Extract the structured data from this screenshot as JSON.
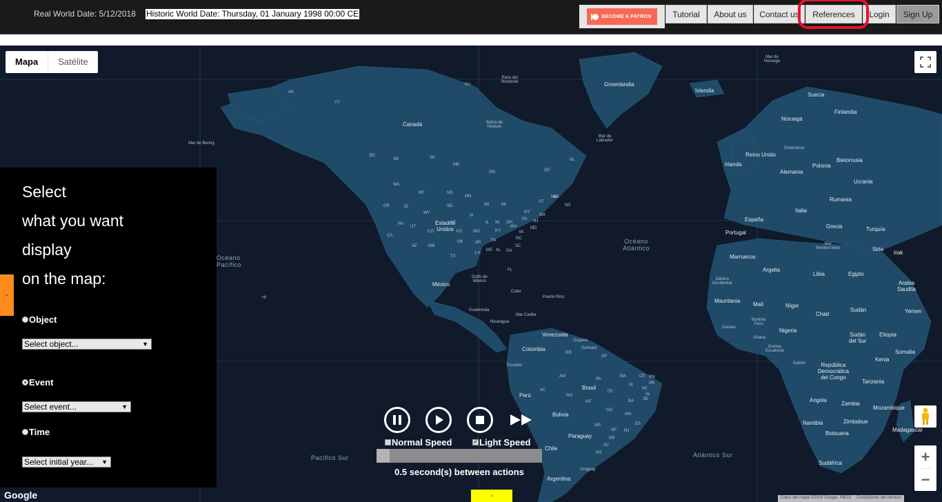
{
  "header": {
    "real_date": "Real World Date: 5/12/2018",
    "historic_date": "Historic World Date: Thursday, 01 January 1998 00:00 CE",
    "patron_label": "BECOME A PATRON",
    "nav": {
      "tutorial": "Tutorial",
      "about": "About us",
      "contact": "Contact us",
      "references": "References",
      "login": "Login",
      "signup": "Sign Up"
    }
  },
  "map": {
    "type_map": "Mapa",
    "type_satellite": "Satélite",
    "google_logo": "Google",
    "attribution_data": "Datos del mapa ©2018 Google, INEGI",
    "attribution_terms": "Condiciones del servicio",
    "zoom_in": "+",
    "zoom_out": "−",
    "oceans": {
      "atlantic": [
        "Océano",
        "Atlántico"
      ],
      "pacific": [
        "Océano",
        "Pacífico"
      ],
      "pacifico_sur": "Pacífico Sur",
      "atlantico_sur": "Atlántico Sur"
    },
    "seas": {
      "bering": "Mar de Bering",
      "bahia_hudson": [
        "Bahía de",
        "Hudson"
      ],
      "labrador": [
        "Mar de",
        "Labrador"
      ],
      "noruega": [
        "Mar de",
        "Noruega"
      ],
      "mar_noroeste": [
        "Paso del",
        "Noroeste"
      ],
      "golfo_mexico": [
        "Golfo de",
        "México"
      ],
      "caribe": "Mar Caribe",
      "mediterraneo": [
        "Mar",
        "Mediterráneo"
      ]
    },
    "countries": {
      "groenlandia": "Groenlandia",
      "islandia": "Islandia",
      "canada": "Canadá",
      "suecia": "Suecia",
      "finlandia": "Finlandia",
      "noruega": "Noruega",
      "irlanda": "Irlanda",
      "reino_unido": "Reino Unido",
      "dinamarca": "Dinamarca",
      "alemania": "Alemania",
      "polonia": "Polonia",
      "bielorrusia": "Bielorrusia",
      "ucrania": "Ucrania",
      "rumania": "Rumania",
      "italia": "Italia",
      "grecia": "Grecia",
      "turquia": "Turquía",
      "espana": "España",
      "portugal": "Portugal",
      "marruecos": "Marruecos",
      "argelia": "Argelia",
      "libia": "Libia",
      "egipto": "Egipto",
      "irak": "Irak",
      "siria": "Siria",
      "arabia": [
        "Arabia",
        "Saudita"
      ],
      "yemen": "Yemen",
      "sahara": [
        "Sáhara",
        "Occidental"
      ],
      "mauritania": "Mauritania",
      "mali": "Malí",
      "niger": "Níger",
      "chad": "Chad",
      "sudan": "Sudán",
      "burkina": [
        "Burkina",
        "Faso"
      ],
      "guinea": "Guinea",
      "nigeria": "Nigeria",
      "etiopia": "Etiopía",
      "sudan_sur": [
        "Sudán",
        "del Sur"
      ],
      "ghana": "Ghana",
      "somalia": "Somalia",
      "kenia": "Kenia",
      "guinea_ec": [
        "Guinea",
        "Ecuatorial"
      ],
      "gabon": "Gabón",
      "rdc": [
        "República",
        "Democrática",
        "del Congo"
      ],
      "tanzania": "Tanzania",
      "angola": "Angola",
      "zambia": "Zambia",
      "mozambique": "Mozambique",
      "namibia": "Namibia",
      "zimbabue": "Zimbabue",
      "botsuana": "Botsuana",
      "madagascar": "Madagascar",
      "sudafrica": "Sudáfrica",
      "eeuu": [
        "Estados",
        "Unidos"
      ],
      "mexico": "México",
      "cuba": "Cuba",
      "puerto_rico": "Puerto Rico",
      "guatemala": "Guatemala",
      "nicaragua": "Nicaragua",
      "venezuela": "Venezuela",
      "guyana": "Guyana",
      "surinam": "Surinam",
      "colombia": "Colombia",
      "ecuador": "Ecuador",
      "peru": "Perú",
      "brasil": "Brasil",
      "bolivia": "Bolivia",
      "paraguay": "Paraguay",
      "chile": "Chile",
      "uruguay": "Uruguay",
      "argentina": "Argentina"
    },
    "states": [
      "AK",
      "YT",
      "NU",
      "BC",
      "AB",
      "SK",
      "MB",
      "ON",
      "QC",
      "NL",
      "NB",
      "NS",
      "WA",
      "MT",
      "ND",
      "MN",
      "WI",
      "MI",
      "NY",
      "VT",
      "ME",
      "OR",
      "ID",
      "WY",
      "SD",
      "IA",
      "IL",
      "IN",
      "OH",
      "PA",
      "NJ",
      "MA",
      "NV",
      "UT",
      "CO",
      "NE",
      "KS",
      "MO",
      "KY",
      "WV",
      "VA",
      "MD",
      "CA",
      "AZ",
      "NM",
      "OK",
      "AR",
      "TN",
      "NC",
      "SC",
      "TX",
      "LA",
      "MS",
      "AL",
      "GA",
      "FL",
      "HI",
      "AM",
      "PA",
      "MA",
      "CE",
      "RN",
      "PB",
      "PE",
      "AL",
      "SE",
      "TO",
      "BA",
      "PI",
      "AC",
      "RO",
      "MT",
      "GO",
      "MG",
      "ES",
      "MS",
      "SP",
      "RJ",
      "PR",
      "SC",
      "RS",
      "AP",
      "RR",
      "MO"
    ]
  },
  "panel": {
    "title_lines": [
      "Select",
      "what you want",
      "display",
      "on the map:"
    ],
    "object_label": "Object",
    "object_select": "Select object...",
    "event_label": "Event",
    "event_select": "Select event...",
    "time_label": "Time",
    "time_select": "Select initial year...",
    "collapse_tab": "-"
  },
  "playback": {
    "normal_speed": "Normal Speed",
    "light_speed": "Light Speed",
    "normal_checked": false,
    "light_checked": true,
    "actions_text": "0.5 second(s) between actions",
    "slider_fraction": 0.08,
    "bottom_tab": "-"
  }
}
